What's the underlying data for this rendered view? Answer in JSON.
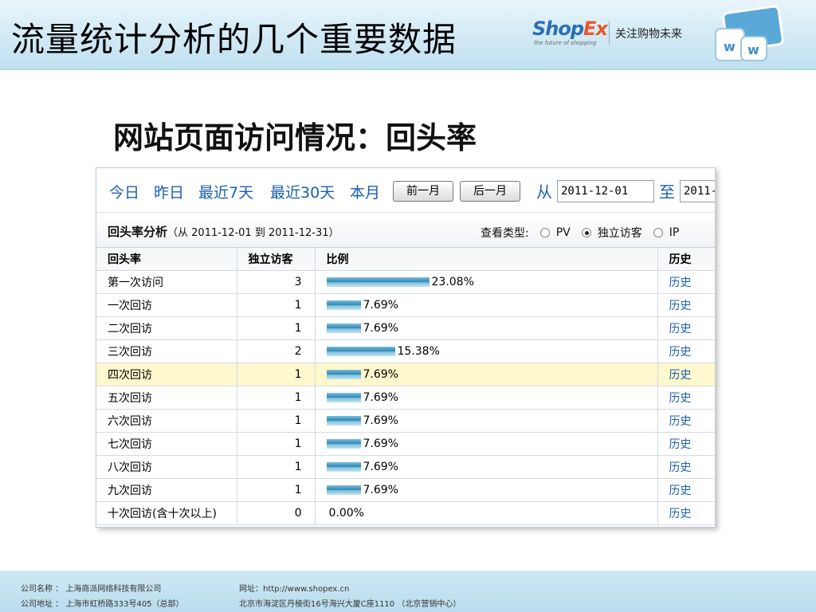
{
  "slide": {
    "title": "流量统计分析的几个重要数据",
    "logo_shop": "Shop",
    "logo_ex": "Ex",
    "logo_tagline": "the future of shopping",
    "logo_slogan": "关注购物未来",
    "subtitle": "网站页面访问情况：回头率"
  },
  "date_bar": {
    "links": [
      "今日",
      "昨日",
      "最近7天",
      "最近30天",
      "本月"
    ],
    "prev_month": "前一月",
    "next_month": "后一月",
    "from_label": "从",
    "from_value": "2011-12-01",
    "to_label": "至",
    "to_value": "2011-"
  },
  "analysis": {
    "title": "回头率分析",
    "range": "（从 2011-12-01 到 2011-12-31）",
    "view_type_label": "查看类型:",
    "options": [
      {
        "label": "PV",
        "selected": false
      },
      {
        "label": "独立访客",
        "selected": true
      },
      {
        "label": "IP",
        "selected": false
      }
    ]
  },
  "table": {
    "headers": [
      "回头率",
      "独立访客",
      "比例",
      "历史"
    ],
    "rows": [
      {
        "label": "第一次访问",
        "visitors": "3",
        "ratio": 0.2308,
        "pct": "23.08%",
        "history": "历史",
        "highlight": false
      },
      {
        "label": "一次回访",
        "visitors": "1",
        "ratio": 0.0769,
        "pct": "7.69%",
        "history": "历史",
        "highlight": false
      },
      {
        "label": "二次回访",
        "visitors": "1",
        "ratio": 0.0769,
        "pct": "7.69%",
        "history": "历史",
        "highlight": false
      },
      {
        "label": "三次回访",
        "visitors": "2",
        "ratio": 0.1538,
        "pct": "15.38%",
        "history": "历史",
        "highlight": false
      },
      {
        "label": "四次回访",
        "visitors": "1",
        "ratio": 0.0769,
        "pct": "7.69%",
        "history": "历史",
        "highlight": true
      },
      {
        "label": "五次回访",
        "visitors": "1",
        "ratio": 0.0769,
        "pct": "7.69%",
        "history": "历史",
        "highlight": false
      },
      {
        "label": "六次回访",
        "visitors": "1",
        "ratio": 0.0769,
        "pct": "7.69%",
        "history": "历史",
        "highlight": false
      },
      {
        "label": "七次回访",
        "visitors": "1",
        "ratio": 0.0769,
        "pct": "7.69%",
        "history": "历史",
        "highlight": false
      },
      {
        "label": "八次回访",
        "visitors": "1",
        "ratio": 0.0769,
        "pct": "7.69%",
        "history": "历史",
        "highlight": false
      },
      {
        "label": "九次回访",
        "visitors": "1",
        "ratio": 0.0769,
        "pct": "7.69%",
        "history": "历史",
        "highlight": false
      },
      {
        "label": "十次回访(含十次以上)",
        "visitors": "0",
        "ratio": 0,
        "pct": "0.00%",
        "history": "历史",
        "highlight": false
      }
    ]
  },
  "footer": {
    "company_label": "公司名称 ：",
    "company": "上海商派网络科技有限公司",
    "address_label": "公司地址 ：",
    "address": "上海市虹桥路333号405（总部）",
    "site_label": "网址：",
    "site": "http://www.shopex.cn",
    "beijing": "北京市海淀区丹棱街16号海兴大厦C座1110 （北京营销中心）"
  },
  "colors": {
    "link": "#1b5fb0",
    "highlight_row": "#fdf8cd",
    "bar": "#2f86b6"
  }
}
